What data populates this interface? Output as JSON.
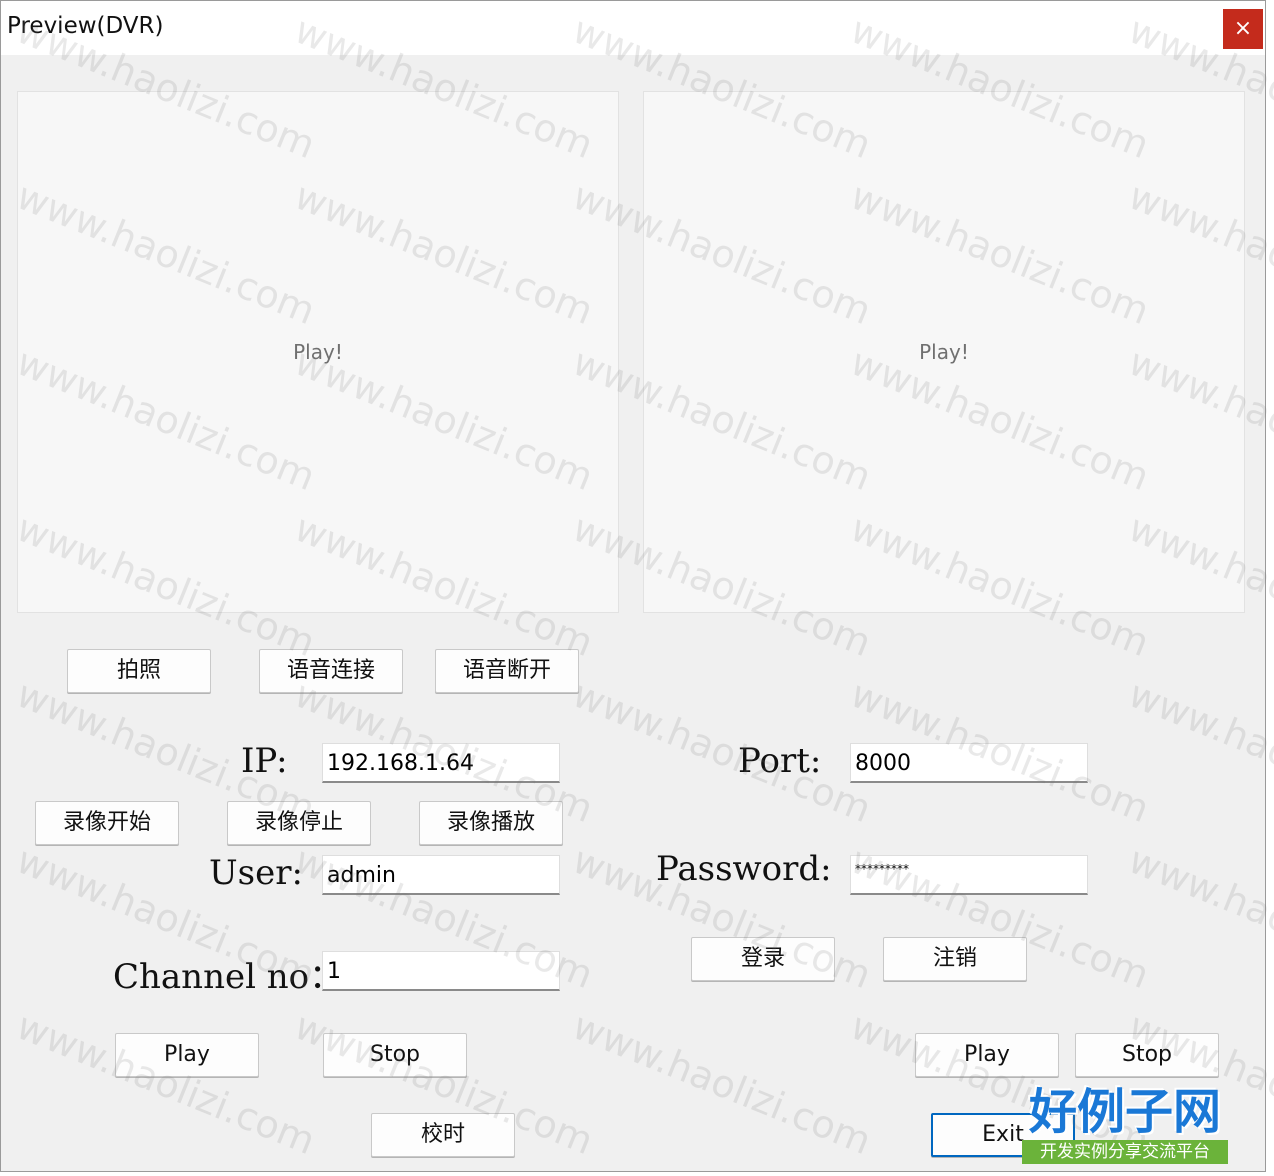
{
  "window": {
    "title": "Preview(DVR)",
    "close_symbol": "×"
  },
  "preview": {
    "left_label": "Play!",
    "right_label": "Play!"
  },
  "buttons": {
    "snapshot": "拍照",
    "voice_connect": "语音连接",
    "voice_disconnect": "语音断开",
    "record_start": "录像开始",
    "record_stop": "录像停止",
    "record_playback": "录像播放",
    "login": "登录",
    "logout": "注销",
    "play_left": "Play",
    "stop_left": "Stop",
    "play_right": "Play",
    "stop_right": "Stop",
    "sync_time": "校时",
    "exit": "Exit"
  },
  "form": {
    "ip_label": "IP:",
    "ip_value": "192.168.1.64",
    "port_label": "Port:",
    "port_value": "8000",
    "user_label": "User:",
    "user_value": "admin",
    "password_label": "Password:",
    "password_value": "*********",
    "channel_label": "Channel no：",
    "channel_value": "1"
  },
  "watermark": {
    "text": "www.haolizi.com"
  },
  "brand": {
    "title": "好例子网",
    "subtitle": "开发实例分享交流平台",
    "title_color": "#1a78d6",
    "subtitle_bg": "#6bb33a"
  },
  "colors": {
    "close_button": "#c42b1c",
    "accent": "#0067c0"
  }
}
